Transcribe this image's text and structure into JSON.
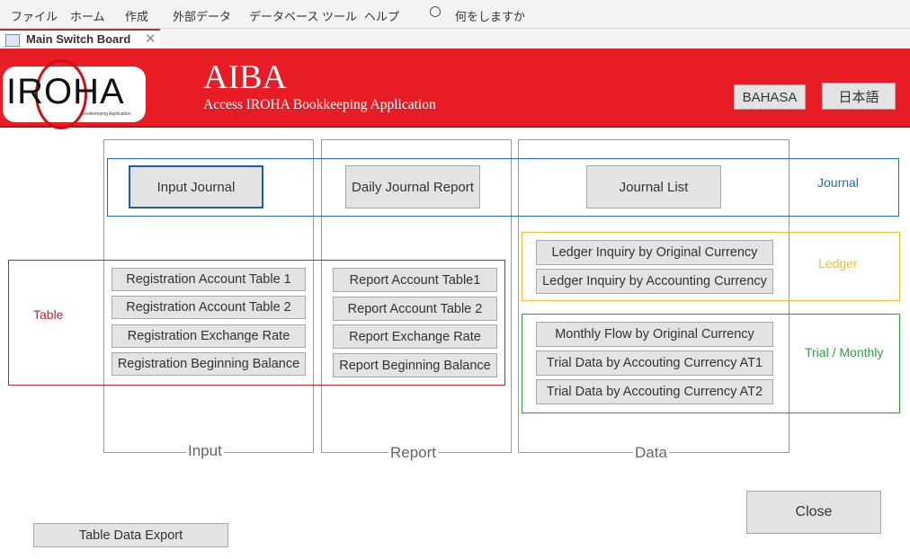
{
  "menu": {
    "items": [
      "ファイル",
      "ホーム",
      "作成",
      "外部データ",
      "データベース ツール",
      "ヘルプ"
    ],
    "search_placeholder": "何をしますか"
  },
  "tab": {
    "title": "Main Switch Board"
  },
  "header": {
    "logo_text": "IROHA",
    "logo_subtext": "Bookkeeping Application",
    "title": "AIBA",
    "subtitle": "Access IROHA Bookkeeping Application",
    "lang_buttons": [
      "BAHASA",
      "日本語"
    ],
    "banner_color": "#e81c24"
  },
  "columns": {
    "input": "Input",
    "report": "Report",
    "data": "Data"
  },
  "groups": {
    "journal": {
      "label": "Journal",
      "color": "#1f6fa8",
      "buttons": [
        "Input Journal",
        "Daily Journal Report",
        "Journal List"
      ]
    },
    "table": {
      "label": "Table",
      "color": "#b8282e",
      "input_buttons": [
        "Registration Account Table 1",
        "Registration Account Table 2",
        "Registration Exchange Rate",
        "Registration Beginning Balance"
      ],
      "report_buttons": [
        "Report Account Table1",
        "Report Account Table 2",
        "Report Exchange Rate",
        "Report Beginning Balance"
      ]
    },
    "ledger": {
      "label": "Ledger",
      "color": "#e8c030",
      "buttons": [
        "Ledger Inquiry by Original Currency",
        "Ledger Inquiry by Accounting Currency"
      ]
    },
    "trial": {
      "label": "Trial / Monthly",
      "color": "#2ea043",
      "buttons": [
        "Monthly Flow by Original Currency",
        "Trial Data by Accouting Currency AT1",
        "Trial Data by Accouting Currency AT2"
      ]
    }
  },
  "footer": {
    "export": "Table Data Export",
    "close": "Close"
  }
}
